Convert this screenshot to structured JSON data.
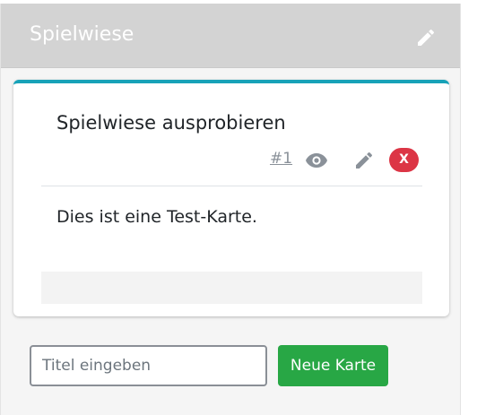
{
  "column": {
    "title": "Spielwiese"
  },
  "card": {
    "title": "Spielwiese ausprobieren",
    "number": "#1",
    "delete_label": "X",
    "body": "Dies ist eine Test-Karte.",
    "accent_color": "#17a2b8"
  },
  "new_card": {
    "placeholder": "Titel eingeben",
    "button_label": "Neue Karte",
    "button_color": "#28a745"
  },
  "icons": [
    "pencil-icon",
    "eye-icon"
  ]
}
